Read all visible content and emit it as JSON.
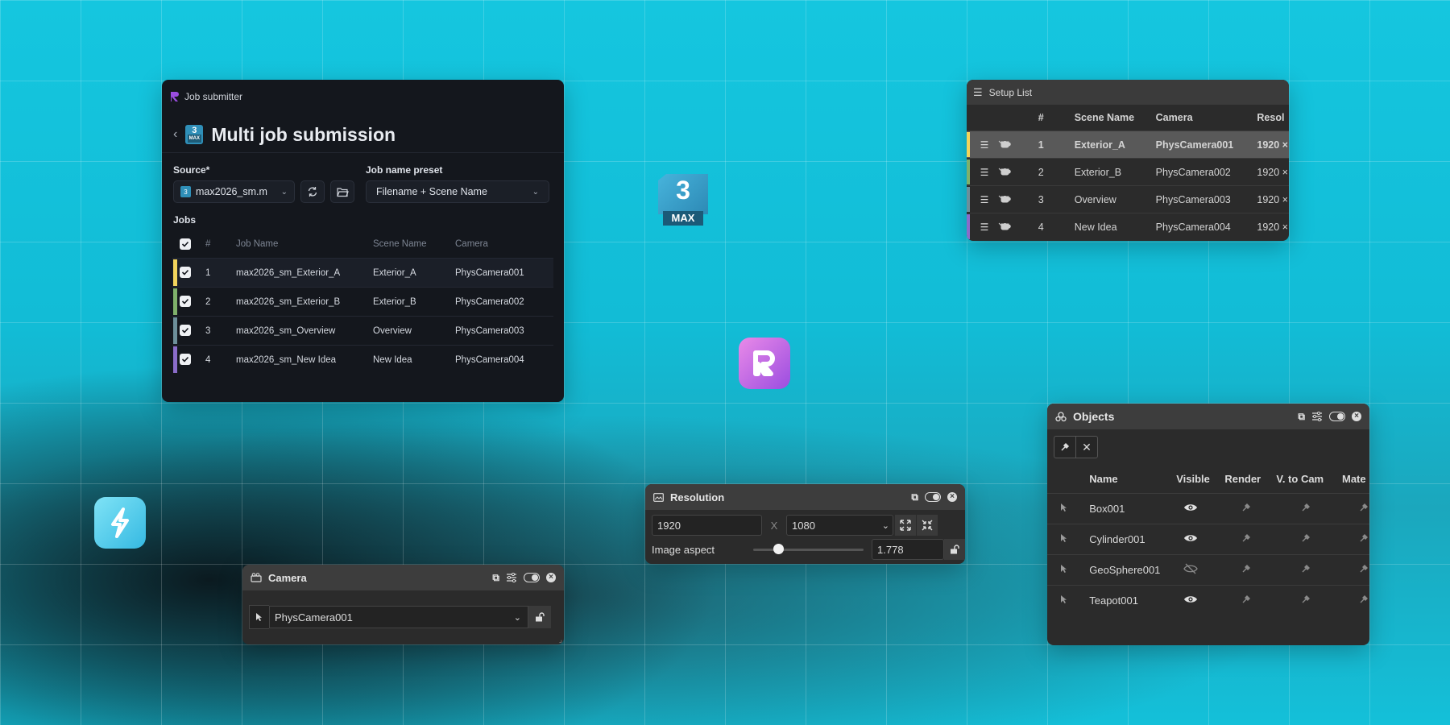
{
  "job_submitter": {
    "app_title": "Job submitter",
    "page_title": "Multi job submission",
    "source_label": "Source*",
    "source_value": "max2026_sm.m",
    "preset_label": "Job name preset",
    "preset_value": "Filename + Scene Name",
    "jobs_label": "Jobs",
    "columns": [
      "#",
      "Job Name",
      "Scene Name",
      "Camera"
    ],
    "rows": [
      {
        "num": "1",
        "job": "max2026_sm_Exterior_A",
        "scene": "Exterior_A",
        "camera": "PhysCamera001",
        "color": "#f2d45c"
      },
      {
        "num": "2",
        "job": "max2026_sm_Exterior_B",
        "scene": "Exterior_B",
        "camera": "PhysCamera002",
        "color": "#7fb06a"
      },
      {
        "num": "3",
        "job": "max2026_sm_Overview",
        "scene": "Overview",
        "camera": "PhysCamera003",
        "color": "#6d8f9a"
      },
      {
        "num": "4",
        "job": "max2026_sm_New Idea",
        "scene": "New Idea",
        "camera": "PhysCamera004",
        "color": "#8a6cc9"
      }
    ]
  },
  "setup_list": {
    "title": "Setup List",
    "columns": [
      "#",
      "Scene Name",
      "Camera",
      "Resol"
    ],
    "rows": [
      {
        "num": "1",
        "scene": "Exterior_A",
        "camera": "PhysCamera001",
        "res": "1920 ×",
        "color": "#f2d45c"
      },
      {
        "num": "2",
        "scene": "Exterior_B",
        "camera": "PhysCamera002",
        "res": "1920 ×",
        "color": "#7fb06a"
      },
      {
        "num": "3",
        "scene": "Overview",
        "camera": "PhysCamera003",
        "res": "1920 ×",
        "color": "#6d8f9a"
      },
      {
        "num": "4",
        "scene": "New Idea",
        "camera": "PhysCamera004",
        "res": "1920 ×",
        "color": "#8a6cc9"
      }
    ]
  },
  "objects": {
    "title": "Objects",
    "columns": [
      "Name",
      "Visible",
      "Render",
      "V. to Cam",
      "Mate"
    ],
    "rows": [
      {
        "name": "Box001",
        "visible": true
      },
      {
        "name": "Cylinder001",
        "visible": true
      },
      {
        "name": "GeoSphere001",
        "visible": false
      },
      {
        "name": "Teapot001",
        "visible": true
      }
    ]
  },
  "resolution": {
    "title": "Resolution",
    "width": "1920",
    "separator": "X",
    "height": "1080",
    "aspect_label": "Image aspect",
    "aspect_value": "1.778",
    "slider_fraction": 0.2
  },
  "camera": {
    "title": "Camera",
    "value": "PhysCamera001"
  },
  "logos": {
    "max_number": "3",
    "max_text": "MAX",
    "tiny_max_text": "MAX"
  },
  "colors": {
    "accent": "#9b4de0",
    "bg": "#14c4dd"
  }
}
